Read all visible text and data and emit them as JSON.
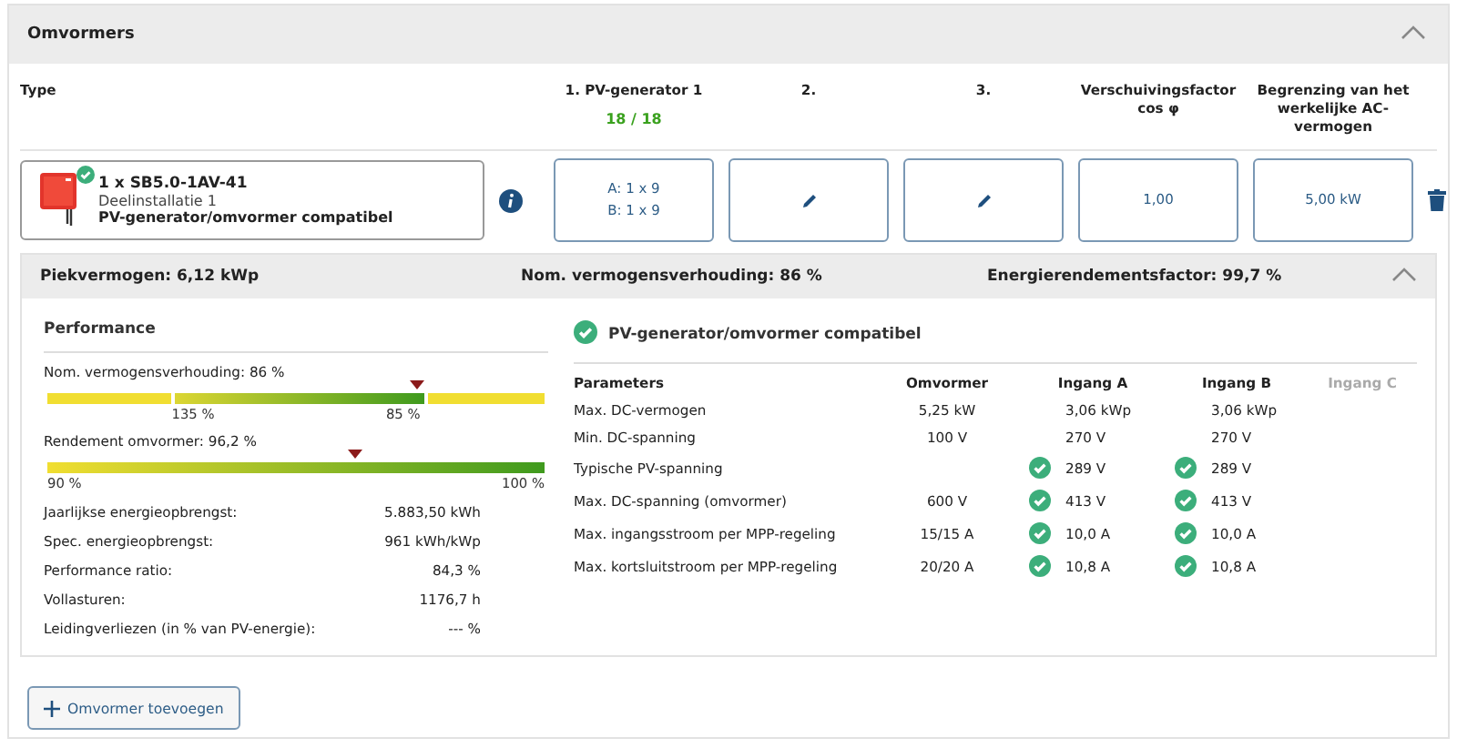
{
  "panel": {
    "title": "Omvormers",
    "expanded": true
  },
  "columns": [
    {
      "label": "Type"
    },
    {
      "label": "1. PV-generator 1",
      "sub": "18 / 18"
    },
    {
      "label": "2."
    },
    {
      "label": "3."
    },
    {
      "label": "Verschuivingsfactor cos φ"
    },
    {
      "label": "Begrenzing van het werkelijke AC-vermogen"
    }
  ],
  "inverter": {
    "title": "1 x SB5.0-1AV-41",
    "subtitle": "Deelinstallatie 1",
    "status": "PV-generator/omvormer compatibel",
    "compatible": true
  },
  "generators": [
    {
      "kind": "lines",
      "lines": [
        "A: 1 x 9",
        "B: 1 x 9"
      ]
    },
    {
      "kind": "edit"
    },
    {
      "kind": "edit"
    }
  ],
  "cos_phi": "1,00",
  "ac_limit": "5,00 kW",
  "summary": {
    "expanded": true,
    "items": [
      "Piekvermogen: 6,12 kWp",
      "Nom. vermogensverhouding: 86 %",
      "Energierendementsfactor: 99,7 %"
    ]
  },
  "performance": {
    "title": "Performance",
    "gauges": [
      {
        "kind": "banded",
        "label": "Nom. vermogensverhouding: 86 %",
        "level": 0.745,
        "ticks": [
          "135 %",
          "85 %"
        ]
      },
      {
        "kind": "full",
        "label": "Rendement omvormer: 96,2 %",
        "level": 0.62,
        "ticks": [
          "90 %",
          "100 %"
        ]
      }
    ],
    "metrics": [
      {
        "label": "Jaarlijkse energieopbrengst:",
        "value": "5.883,50 kWh"
      },
      {
        "label": "Spec. energieopbrengst:",
        "value": "961 kWh/kWp"
      },
      {
        "label": "Performance ratio:",
        "value": "84,3 %"
      },
      {
        "label": "Vollasturen:",
        "value": "1176,7 h"
      },
      {
        "label": "Leidingverliezen (in % van PV-energie):",
        "value": "--- %"
      }
    ]
  },
  "compat": {
    "title": "PV-generator/omvormer compatibel",
    "ok": true,
    "columns": [
      {
        "label": "Parameters",
        "disabled": false
      },
      {
        "label": "Omvormer",
        "disabled": false
      },
      {
        "label": "Ingang A",
        "disabled": false
      },
      {
        "label": "Ingang B",
        "disabled": false
      },
      {
        "label": "Ingang C",
        "disabled": true
      }
    ],
    "rows": [
      {
        "cells": [
          {
            "text": "Max. DC-vermogen"
          },
          {
            "text": "5,25 kW"
          },
          {
            "text": "3,06 kWp",
            "ok": false
          },
          {
            "text": "3,06 kWp",
            "ok": false
          }
        ]
      },
      {
        "cells": [
          {
            "text": "Min. DC-spanning"
          },
          {
            "text": "100 V"
          },
          {
            "text": "270 V",
            "ok": false
          },
          {
            "text": "270 V",
            "ok": false
          }
        ]
      },
      {
        "cells": [
          {
            "text": "Typische PV-spanning"
          },
          {
            "text": ""
          },
          {
            "text": "289 V",
            "ok": true
          },
          {
            "text": "289 V",
            "ok": true
          }
        ]
      },
      {
        "cells": [
          {
            "text": "Max. DC-spanning (omvormer)"
          },
          {
            "text": "600 V"
          },
          {
            "text": "413 V",
            "ok": true
          },
          {
            "text": "413 V",
            "ok": true
          }
        ]
      },
      {
        "cells": [
          {
            "text": "Max. ingangsstroom per MPP-regeling"
          },
          {
            "text": "15/15 A"
          },
          {
            "text": "10,0 A",
            "ok": true
          },
          {
            "text": "10,0 A",
            "ok": true
          }
        ]
      },
      {
        "cells": [
          {
            "text": "Max. kortsluitstroom per MPP-regeling"
          },
          {
            "text": "20/20 A"
          },
          {
            "text": "10,8 A",
            "ok": true
          },
          {
            "text": "10,8 A",
            "ok": true
          }
        ]
      }
    ]
  },
  "add_button": {
    "label": "Omvormer toevoegen"
  }
}
